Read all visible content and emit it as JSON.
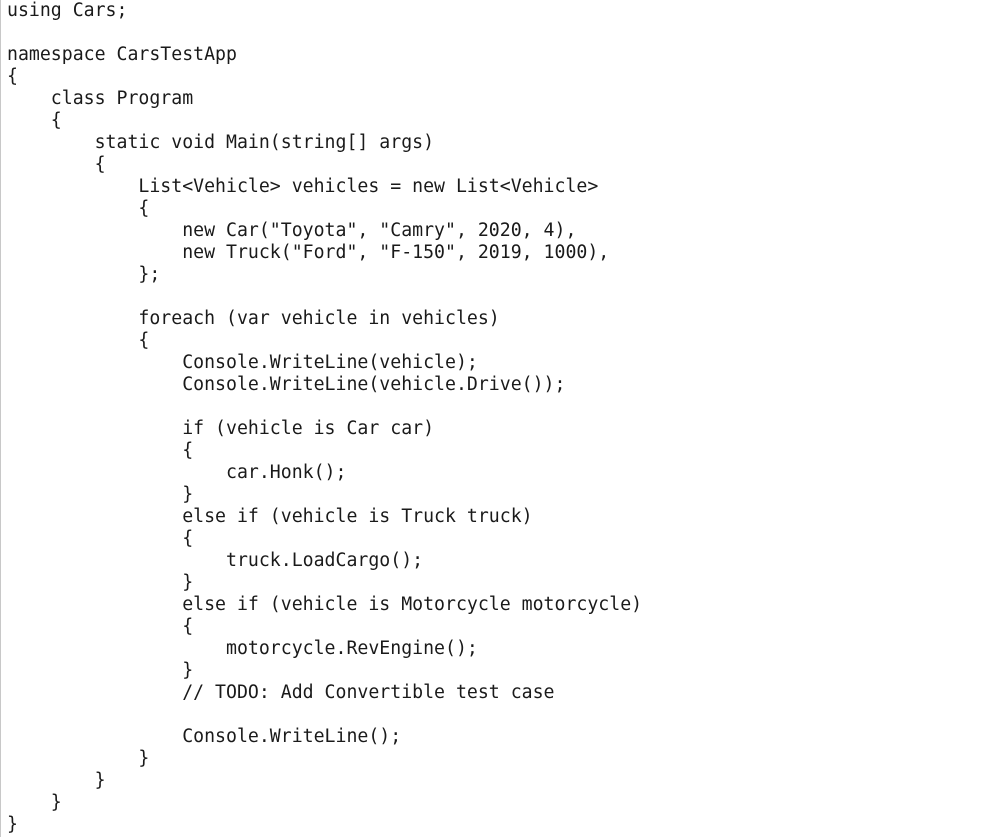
{
  "editor": {
    "lines": [
      "using Cars;",
      "",
      "namespace CarsTestApp",
      "{",
      "    class Program",
      "    {",
      "        static void Main(string[] args)",
      "        {",
      "            List<Vehicle> vehicles = new List<Vehicle>",
      "            {",
      "                new Car(\"Toyota\", \"Camry\", 2020, 4),",
      "                new Truck(\"Ford\", \"F-150\", 2019, 1000),",
      "            };",
      "",
      "            foreach (var vehicle in vehicles)",
      "            {",
      "                Console.WriteLine(vehicle);",
      "                Console.WriteLine(vehicle.Drive());",
      "",
      "                if (vehicle is Car car)",
      "                {",
      "                    car.Honk();",
      "                }",
      "                else if (vehicle is Truck truck)",
      "                {",
      "                    truck.LoadCargo();",
      "                }",
      "                else if (vehicle is Motorcycle motorcycle)",
      "                {",
      "                    motorcycle.RevEngine();",
      "                }",
      "                // TODO: Add Convertible test case",
      "",
      "                Console.WriteLine();",
      "            }",
      "        }",
      "    }",
      "}"
    ]
  }
}
